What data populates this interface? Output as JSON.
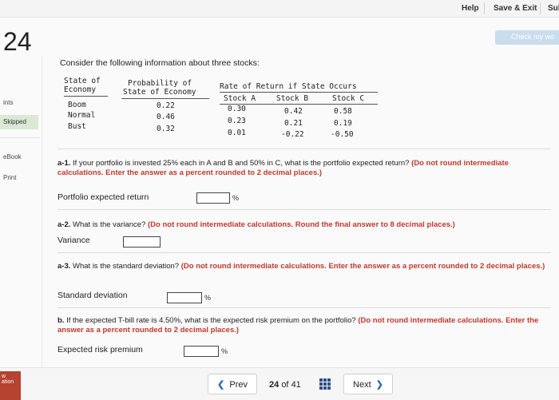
{
  "topbar": {
    "help": "Help",
    "save_exit": "Save & Exit",
    "submit": "Sul"
  },
  "check_button": "Check my wo",
  "question_number": "24",
  "sidebar": {
    "points": "ints",
    "status": "Skipped",
    "ebook": "eBook",
    "print": "Print",
    "corner_top": "w",
    "corner_bottom": "ation"
  },
  "intro": "Consider the following information about three stocks:",
  "table": {
    "h1a": "State of",
    "h1b": "Economy",
    "h2a": "Probability of",
    "h2b": "State of Economy",
    "h3": "Rate of Return if State Occurs",
    "cols": [
      "Stock A",
      "Stock B",
      "Stock C"
    ],
    "rows": [
      {
        "state": "Boom",
        "prob": "0.22",
        "a": "0.30",
        "b": "0.42",
        "c": "0.58"
      },
      {
        "state": "Normal",
        "prob": "0.46",
        "a": "0.23",
        "b": "0.21",
        "c": "0.19"
      },
      {
        "state": "Bust",
        "prob": "0.32",
        "a": "0.01",
        "b": "-0.22",
        "c": "-0.50"
      }
    ]
  },
  "a1": {
    "num": "a-1.",
    "text": " If your portfolio is invested 25% each in A and B and 50% in C, what is the portfolio expected return? ",
    "note": "(Do not round intermediate calculations. Enter the answer as a percent rounded to 2 decimal places.)",
    "label": "Portfolio expected return",
    "unit": "%",
    "value": ""
  },
  "a2": {
    "num": "a-2.",
    "text": " What is the variance? ",
    "note": "(Do not round intermediate calculations. Round the final answer to 8 decimal places.)",
    "label": "Variance",
    "value": ""
  },
  "a3": {
    "num": "a-3.",
    "text": " What is the standard deviation? ",
    "note": "(Do not round intermediate calculations. Enter the answer as a percent rounded to 2 decimal places.)",
    "label": "Standard deviation",
    "unit": "%",
    "value": ""
  },
  "b": {
    "num": "b.",
    "text": " If the expected T-bill rate is 4.50%, what is the expected risk premium on the portfolio? ",
    "note": "(Do not round intermediate calculations. Enter the answer as a percent rounded to 2 decimal places.)",
    "label": "Expected risk premium",
    "unit": "%",
    "value": ""
  },
  "nav": {
    "prev": "Prev",
    "current": "24",
    "of": "of",
    "total": "41",
    "next": "Next"
  }
}
